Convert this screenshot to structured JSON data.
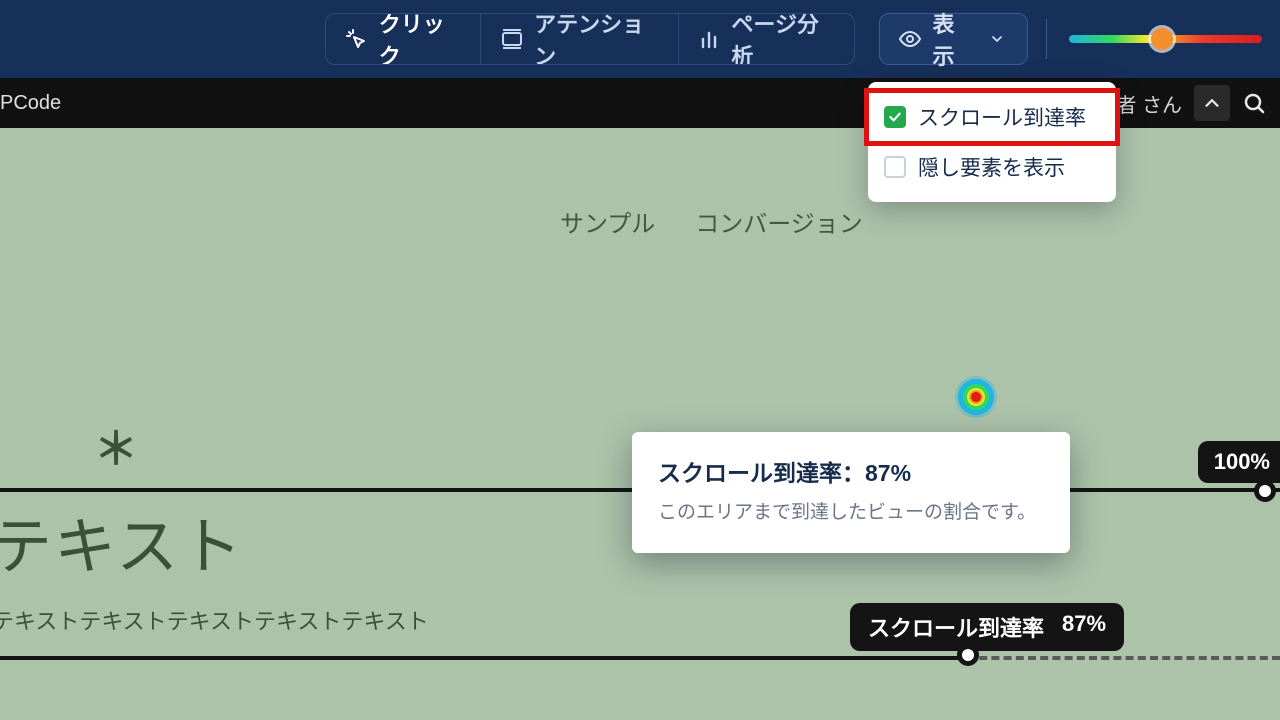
{
  "toolbar": {
    "tabs": {
      "click": {
        "label": "クリック"
      },
      "attention": {
        "label": "アテンション"
      },
      "page": {
        "label": "ページ分析"
      }
    },
    "display": {
      "label": "表示",
      "dropdown": {
        "scroll_reach": {
          "label": "スクロール到達率",
          "checked": true
        },
        "hidden_elems": {
          "label": "隠し要素を表示",
          "checked": false
        }
      }
    }
  },
  "siteheader": {
    "brand": "PCode",
    "user_suffix": "者 さん"
  },
  "page": {
    "crumbs": [
      "サンプル",
      "コンバージョン"
    ],
    "hero_mark": "＊",
    "hero_text": "テキスト",
    "body_text": "テキストテキストテキストテキストテキスト"
  },
  "tooltip": {
    "title": "スクロール到達率：87%",
    "desc": "このエリアまで到達したビューの割合です。"
  },
  "scroll_markers": {
    "full": {
      "label": "100%"
    },
    "current": {
      "label": "スクロール到達率",
      "value": "87%"
    }
  }
}
